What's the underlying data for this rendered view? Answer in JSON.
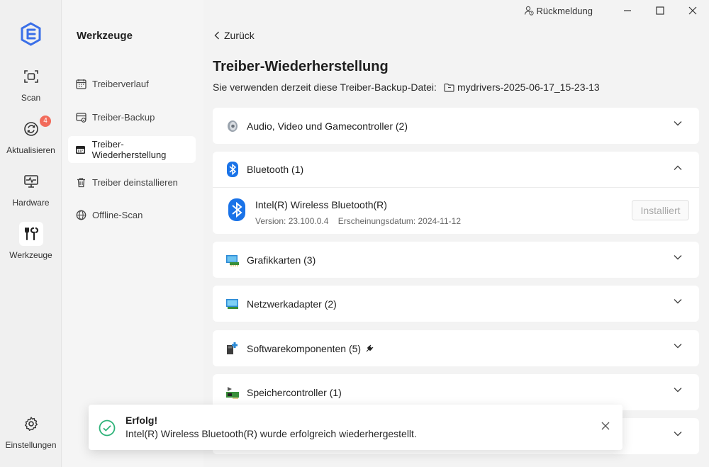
{
  "rail": {
    "items": [
      {
        "label": "Scan",
        "icon": "scan-icon"
      },
      {
        "label": "Aktualisieren",
        "icon": "refresh-icon",
        "badge": "4"
      },
      {
        "label": "Hardware",
        "icon": "monitor-pulse-icon"
      },
      {
        "label": "Werkzeuge",
        "icon": "tools-icon",
        "active": true
      },
      {
        "label": "Einstellungen",
        "icon": "gear-icon"
      }
    ]
  },
  "sidebar": {
    "title": "Werkzeuge",
    "items": [
      {
        "label": "Treiberverlauf",
        "icon": "calendar-icon"
      },
      {
        "label": "Treiber-Backup",
        "icon": "backup-icon"
      },
      {
        "label": "Treiber-Wiederherstellung",
        "icon": "restore-icon",
        "active": true
      },
      {
        "label": "Treiber deinstallieren",
        "icon": "trash-icon"
      },
      {
        "label": "Offline-Scan",
        "icon": "globe-icon"
      }
    ]
  },
  "titlebar": {
    "feedback": "Rückmeldung"
  },
  "main": {
    "back": "Zurück",
    "title": "Treiber-Wiederherstellung",
    "subtitle": "Sie verwenden derzeit diese Treiber-Backup-Datei:",
    "backup_file": "mydrivers-2025-06-17_15-23-13",
    "categories": [
      {
        "label": "Audio, Video und Gamecontroller (2)",
        "icon": "speaker-icon"
      },
      {
        "label": "Bluetooth (1)",
        "icon": "bluetooth-icon",
        "expanded": true
      },
      {
        "label": "Grafikkarten (3)",
        "icon": "display-adapter-icon"
      },
      {
        "label": "Netzwerkadapter (2)",
        "icon": "network-adapter-icon"
      },
      {
        "label": "Softwarekomponenten (5)",
        "icon": "software-component-icon"
      },
      {
        "label": "Speichercontroller (1)",
        "icon": "storage-controller-icon"
      }
    ],
    "bluetooth_driver": {
      "name": "Intel(R) Wireless Bluetooth(R)",
      "version": "Version: 23.100.0.4",
      "release": "Erscheinungsdatum: 2024-11-12",
      "button": "Installiert"
    }
  },
  "toast": {
    "title": "Erfolg!",
    "message": "Intel(R) Wireless Bluetooth(R) wurde erfolgreich wiederhergestellt."
  },
  "colors": {
    "accent": "#2f6fe4",
    "success": "#2fb37a",
    "badge": "#f26b5b"
  }
}
